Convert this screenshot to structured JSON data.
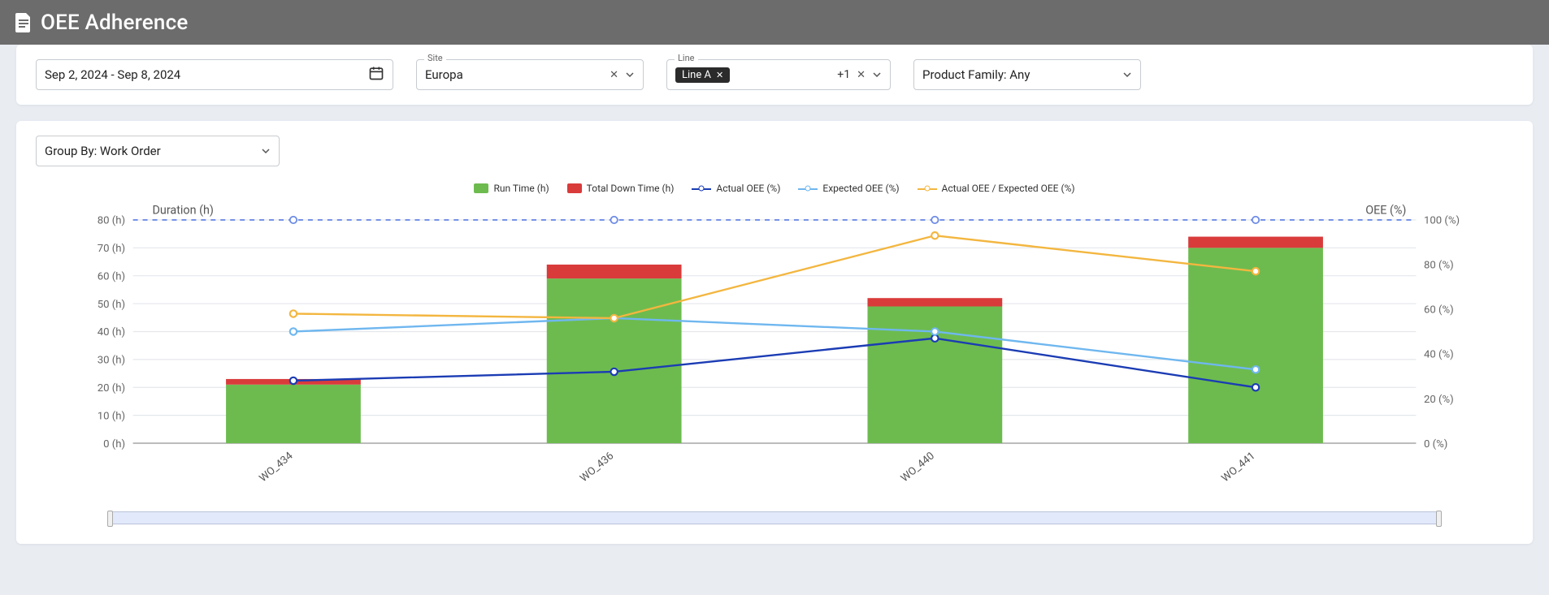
{
  "header": {
    "title": "OEE Adherence"
  },
  "filters": {
    "date_range": "Sep 2, 2024 - Sep 8, 2024",
    "site_label": "Site",
    "site_value": "Europa",
    "line_label": "Line",
    "line_chip": "Line A",
    "line_extra": "+1",
    "pf_value": "Product Family: Any"
  },
  "group_by": {
    "value": "Group By: Work Order"
  },
  "legend": {
    "run": "Run Time (h)",
    "down": "Total Down Time (h)",
    "actual": "Actual OEE (%)",
    "expected": "Expected OEE (%)",
    "ratio": "Actual OEE / Expected OEE (%)"
  },
  "axis": {
    "left_title": "Duration (h)",
    "right_title": "OEE (%)"
  },
  "colors": {
    "run": "#6dbb4f",
    "down": "#d93b3b",
    "actual": "#1b3cb4",
    "expected": "#6fb7ef",
    "ratio": "#f3b63f",
    "target_line": "#6d8be6",
    "grid": "#e4e7eb",
    "axis": "#999"
  },
  "chart_data": {
    "type": "bar+line",
    "categories": [
      "WO_434",
      "WO_436",
      "WO_440",
      "WO_441"
    ],
    "left_axis": {
      "label": "Duration (h)",
      "min": 0,
      "max": 80,
      "step": 10,
      "unit": "(h)"
    },
    "right_axis": {
      "label": "OEE (%)",
      "min": 0,
      "max": 100,
      "step": 20,
      "unit": "(%)"
    },
    "series": [
      {
        "name": "Run Time (h)",
        "kind": "bar",
        "axis": "left",
        "color": "run",
        "values": [
          21,
          59,
          49,
          70
        ]
      },
      {
        "name": "Total Down Time (h)",
        "kind": "bar",
        "axis": "left",
        "color": "down",
        "values": [
          2,
          5,
          3,
          4
        ]
      },
      {
        "name": "Actual OEE (%)",
        "kind": "line",
        "axis": "right",
        "color": "actual",
        "values": [
          28,
          32,
          47,
          25
        ]
      },
      {
        "name": "Expected OEE (%)",
        "kind": "line",
        "axis": "right",
        "color": "expected",
        "values": [
          50,
          56,
          50,
          33
        ]
      },
      {
        "name": "Actual OEE / Expected OEE (%)",
        "kind": "line",
        "axis": "right",
        "color": "ratio",
        "values": [
          58,
          56,
          93,
          77
        ]
      }
    ],
    "target_line": {
      "axis": "right",
      "value": 100,
      "style": "dashed",
      "color": "target_line"
    }
  }
}
